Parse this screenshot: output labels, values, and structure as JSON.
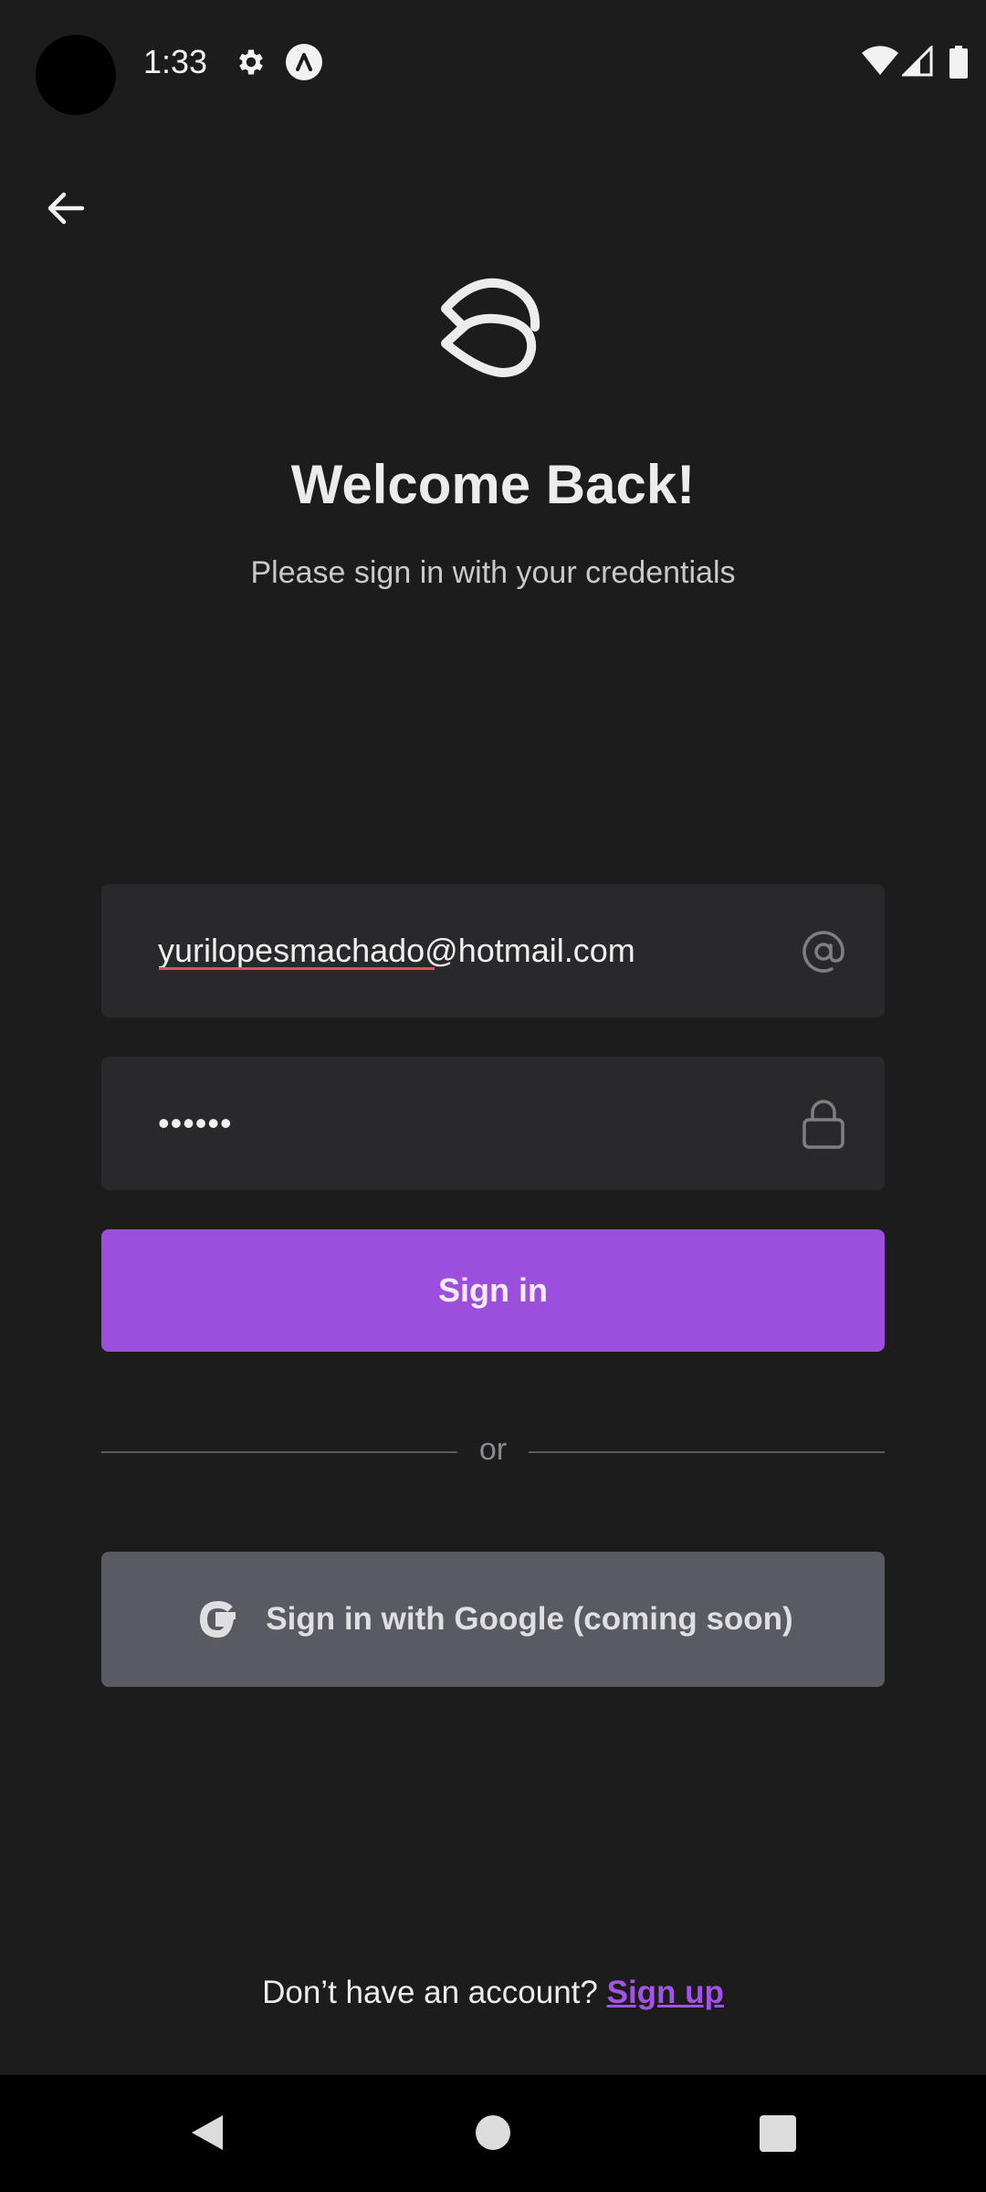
{
  "status_bar": {
    "time": "1:33",
    "icons": [
      "gear-icon",
      "a-badge-icon",
      "wifi-icon",
      "signal-icon",
      "battery-icon"
    ]
  },
  "header": {
    "back_icon": "arrow-left-icon"
  },
  "hero": {
    "logo_icon": "app-logo-icon",
    "title": "Welcome Back!",
    "subtitle": "Please sign in with your credentials"
  },
  "form": {
    "email": {
      "value": "yurilopesmachado@hotmail.com",
      "icon": "at-sign-icon"
    },
    "password": {
      "value": "••••••",
      "icon": "lock-icon"
    },
    "signin_label": "Sign in",
    "divider_text": "or",
    "google_label": "Sign in with Google (coming soon)",
    "google_icon": "google-g-icon"
  },
  "footer": {
    "prompt": "Don’t have an account?",
    "signup_label": "Sign up"
  },
  "colors": {
    "background": "#1c1c1d",
    "field": "#29292b",
    "primary": "#9c4fdd",
    "google_button": "#5a5a63",
    "link": "#a552e8"
  }
}
